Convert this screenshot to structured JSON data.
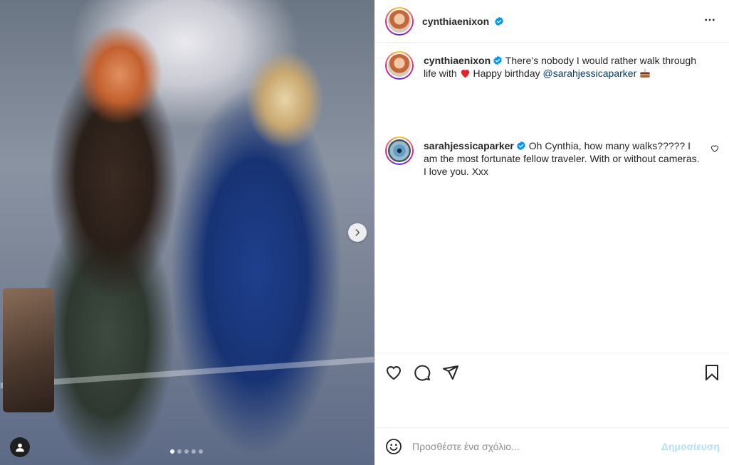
{
  "post": {
    "photo_count": 5,
    "active_photo": 1
  },
  "header": {
    "username": "cynthiaenixon",
    "verified": true,
    "more_icon": "more-horizontal-icon"
  },
  "caption": {
    "username": "cynthiaenixon",
    "text_before": " There’s nobody I would rather walk through life with ",
    "text_middle": " Happy birthday ",
    "mention": "@sarahjessicaparker",
    "emoji_heart": "red-heart-emoji",
    "emoji_cake": "cake-emoji"
  },
  "comments": [
    {
      "username": "sarahjessicaparker",
      "verified": true,
      "text": " Oh Cynthia, how many walks????? I am the most fortunate fellow traveler. With or without cameras. I love you. Xxx"
    }
  ],
  "actions": {
    "like_icon": "heart-icon",
    "comment_icon": "comment-icon",
    "share_icon": "send-icon",
    "save_icon": "bookmark-icon"
  },
  "composer": {
    "placeholder": "Προσθέστε ένα σχόλιο...",
    "post_label": "Δημοσίευση",
    "post_color": "#b2dffc"
  },
  "colors": {
    "verified": "#0095f6",
    "mention": "#00376b",
    "heart": "#ed4956"
  }
}
